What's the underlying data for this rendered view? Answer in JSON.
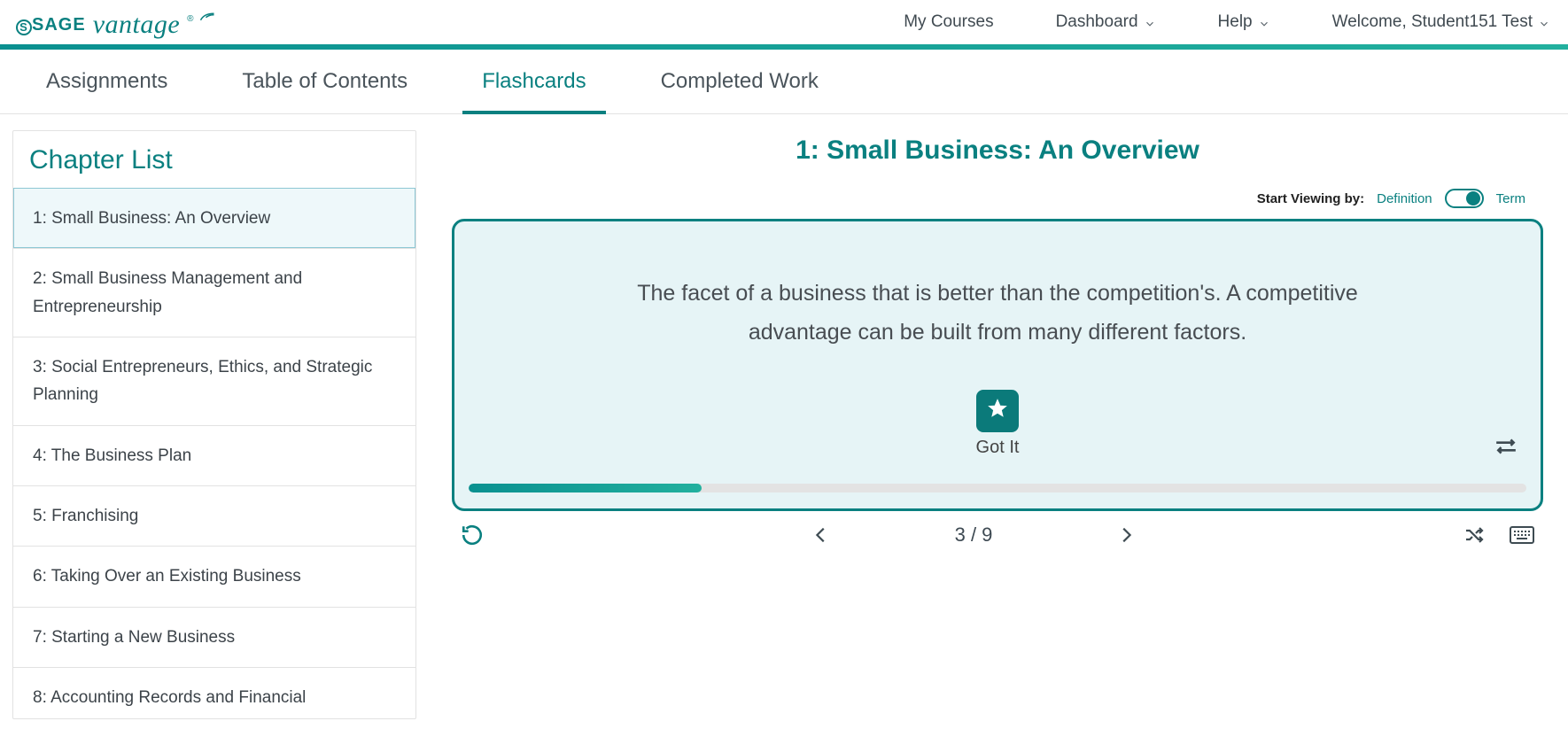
{
  "brand": {
    "sage": "SAGE",
    "vantage": "vantage",
    "reg": "®"
  },
  "topnav": {
    "my_courses": "My Courses",
    "dashboard": "Dashboard",
    "help": "Help",
    "welcome": "Welcome, Student151 Test"
  },
  "tabs": {
    "assignments": "Assignments",
    "toc": "Table of Contents",
    "flashcards": "Flashcards",
    "completed": "Completed Work"
  },
  "sidebar": {
    "title": "Chapter List",
    "chapters": [
      "1: Small Business: An Overview",
      "2: Small Business Management and Entrepreneurship",
      "3: Social Entrepreneurs, Ethics, and Strategic Planning",
      "4: The Business Plan",
      "5: Franchising",
      "6: Taking Over an Existing Business",
      "7: Starting a New Business",
      "8: Accounting Records and Financial"
    ],
    "selected_index": 0
  },
  "flashcard": {
    "heading": "1: Small Business: An Overview",
    "start_label": "Start Viewing by:",
    "opt_definition": "Definition",
    "opt_term": "Term",
    "text": "The facet of a business that is better than the competition's. A competitive advantage can be built from many different factors.",
    "got_it": "Got It",
    "counter": "3 / 9",
    "progress_pct": 22
  }
}
